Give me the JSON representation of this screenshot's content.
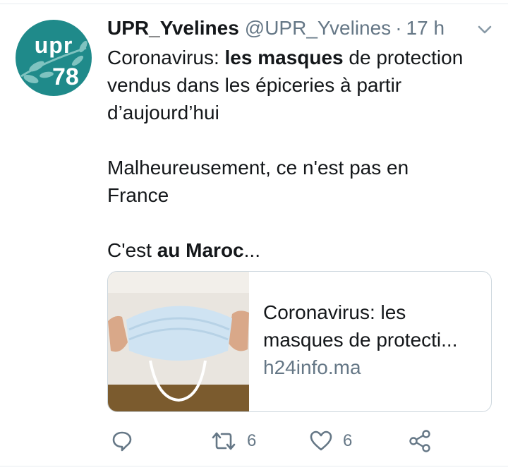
{
  "tweet": {
    "display_name": "UPR_Yvelines",
    "handle": "@UPR_Yvelines",
    "separator": "·",
    "time": "17 h",
    "avatar": {
      "top_text": "upr",
      "bottom_text": "78",
      "color": "#1f8a8a"
    },
    "text": {
      "p1": {
        "a": "Coronavirus: ",
        "b": "les masques",
        "c": " de protection",
        "l2": "vendus dans les épiceries à partir",
        "l3": "d’aujourd’hui"
      },
      "p2": {
        "l1": "Malheureusement, ce n'est pas en",
        "l2": "France"
      },
      "p3": {
        "a": "C'est ",
        "b": "au Maroc",
        "c": "..."
      }
    },
    "card": {
      "title_line1": "Coronavirus: les",
      "title_line2": "masques de protecti...",
      "domain": "h24info.ma"
    },
    "actions": {
      "reply": {
        "icon": "reply-icon"
      },
      "retweet": {
        "icon": "retweet-icon",
        "count": "6"
      },
      "like": {
        "icon": "heart-icon",
        "count": "6"
      },
      "share": {
        "icon": "share-icon"
      }
    }
  },
  "colors": {
    "text": "#14171a",
    "secondary": "#657786",
    "border": "#ccd6dd",
    "accent": "#1f8a8a"
  }
}
